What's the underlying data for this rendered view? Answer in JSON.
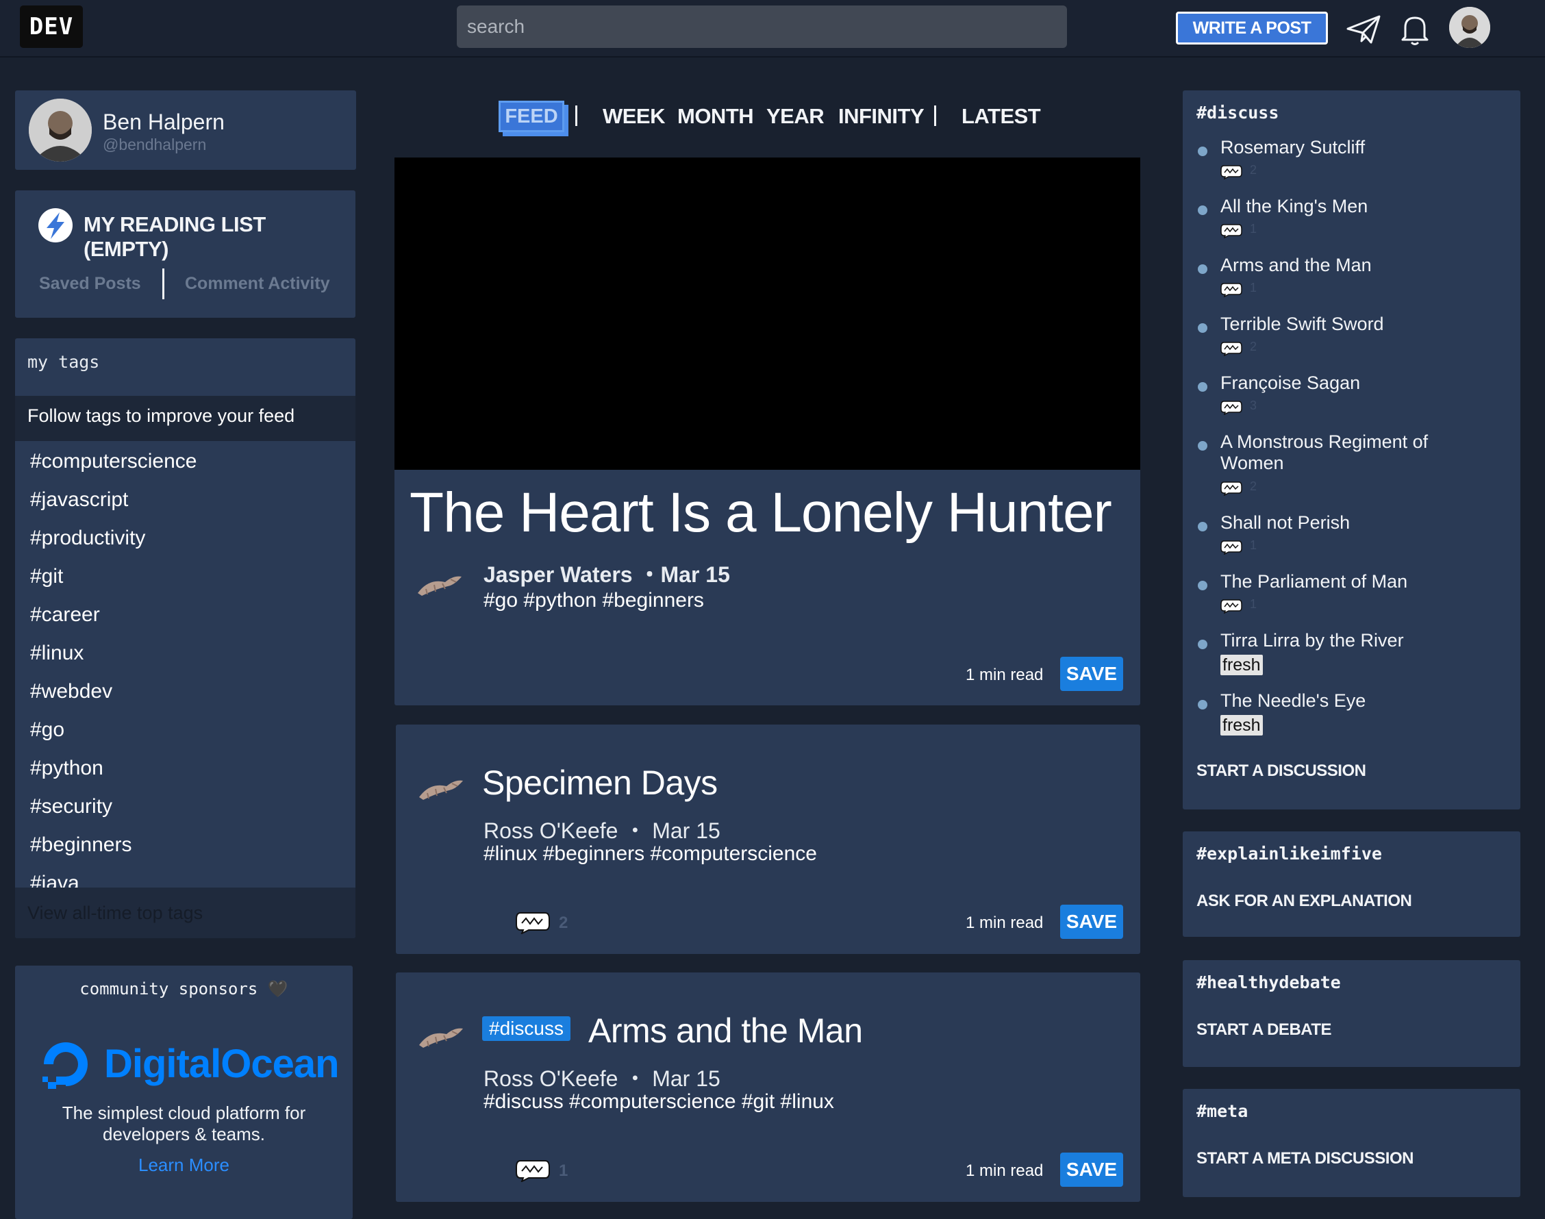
{
  "header": {
    "logo": "DEV",
    "search_placeholder": "search",
    "write_label": "WRITE A POST"
  },
  "profile": {
    "name": "Ben Halpern",
    "handle": "@bendhalpern"
  },
  "reading_list": {
    "title": "MY READING LIST (EMPTY)",
    "tabs": [
      "Saved Posts",
      "Comment Activity"
    ]
  },
  "tags": {
    "heading": "my tags",
    "follow_text": "Follow tags to improve your feed",
    "items": [
      "#computerscience",
      "#javascript",
      "#productivity",
      "#git",
      "#career",
      "#linux",
      "#webdev",
      "#go",
      "#python",
      "#security",
      "#beginners",
      "#java"
    ],
    "view_all": "View all-time top tags"
  },
  "sponsors": {
    "heading": "community sponsors",
    "heart": "🖤",
    "sponsor_name": "DigitalOcean",
    "description_line1": "The simplest cloud platform for",
    "description_line2": "developers & teams.",
    "learn_more": "Learn More",
    "brand_color": "#0080ff"
  },
  "feed_filters": {
    "active": "FEED",
    "items": [
      "WEEK",
      "MONTH",
      "YEAR",
      "INFINITY"
    ],
    "latest": "LATEST"
  },
  "posts": [
    {
      "title": "The Heart Is a Lonely Hunter",
      "author": "Jasper Waters",
      "date": "Mar 15",
      "tags": "#go  #python  #beginners",
      "read_time": "1 min read",
      "save_label": "SAVE"
    },
    {
      "title": "Specimen Days",
      "author": "Ross O'Keefe",
      "date": "Mar 15",
      "tags": "#linux  #beginners  #computerscience",
      "comments": "2",
      "read_time": "1 min read",
      "save_label": "SAVE"
    },
    {
      "pill": "#discuss",
      "title": "Arms and the Man",
      "author": "Ross O'Keefe",
      "date": "Mar 15",
      "tags": "#discuss  #computerscience  #git  #linux",
      "comments": "1",
      "read_time": "1 min read",
      "save_label": "SAVE"
    }
  ],
  "discuss": {
    "heading": "#discuss",
    "items": [
      {
        "title": "Rosemary Sutcliff",
        "count": "2"
      },
      {
        "title": "All the King's Men",
        "count": "1"
      },
      {
        "title": "Arms and the Man",
        "count": "1"
      },
      {
        "title": "Terrible Swift Sword",
        "count": "2"
      },
      {
        "title": "Françoise Sagan",
        "count": "3"
      },
      {
        "title": "A Monstrous Regiment of Women",
        "count": "2"
      },
      {
        "title": "Shall not Perish",
        "count": "1"
      },
      {
        "title": "The Parliament of Man",
        "count": "1"
      },
      {
        "title": "Tirra Lirra by the River",
        "badge": "fresh"
      },
      {
        "title": "The Needle's Eye",
        "badge": "fresh"
      }
    ],
    "action": "START A DISCUSSION"
  },
  "explain": {
    "heading": "#explainlikeimfive",
    "action": "ASK FOR AN EXPLANATION"
  },
  "debate": {
    "heading": "#healthydebate",
    "action": "START A DEBATE"
  },
  "meta": {
    "heading": "#meta",
    "action": "START A META DISCUSSION"
  },
  "icons": {
    "header": [
      "paper-plane-icon",
      "bell-icon"
    ],
    "comment": "comment-bubble-icon",
    "reading_list": "bolt-icon",
    "sponsor_logo": "digitalocean-logo"
  }
}
